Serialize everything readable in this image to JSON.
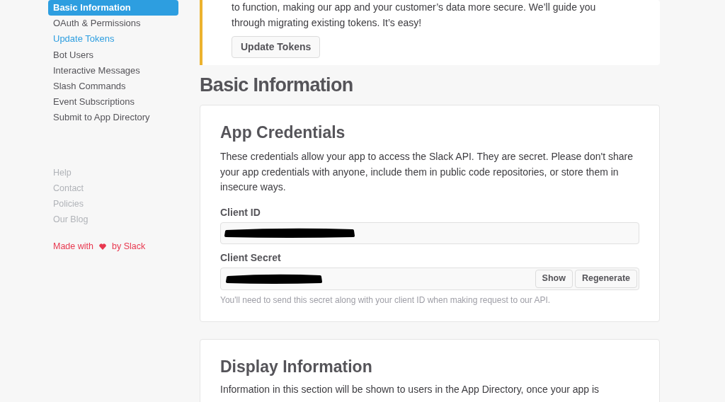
{
  "sidebar": {
    "items": [
      {
        "label": "Basic Information",
        "selected": true,
        "kind": "nav"
      },
      {
        "label": "OAuth & Permissions",
        "selected": false,
        "kind": "nav"
      },
      {
        "label": "Update Tokens",
        "selected": false,
        "kind": "highlight"
      },
      {
        "label": "Bot Users",
        "selected": false,
        "kind": "nav"
      },
      {
        "label": "Interactive Messages",
        "selected": false,
        "kind": "nav"
      },
      {
        "label": "Slash Commands",
        "selected": false,
        "kind": "nav"
      },
      {
        "label": "Event Subscriptions",
        "selected": false,
        "kind": "nav"
      },
      {
        "label": "Submit to App Directory",
        "selected": false,
        "kind": "nav"
      }
    ],
    "footer_links": [
      "Help",
      "Contact",
      "Policies",
      "Our Blog"
    ],
    "made_with": {
      "before": "Made with",
      "after": "by Slack"
    }
  },
  "banner": {
    "text": "to function, making our app and your customer’s data more secure. We’ll guide you through migrating existing tokens. It’s easy!",
    "button": "Update Tokens"
  },
  "page_title": "Basic Information",
  "credentials": {
    "title": "App Credentials",
    "description": "These credentials allow your app to access the Slack API. They are secret. Please don't share your app credentials with anyone, include them in public code repositories, or store them in insecure ways.",
    "client_id": {
      "label": "Client ID"
    },
    "client_secret": {
      "label": "Client Secret",
      "buttons": [
        "Show",
        "Regenerate"
      ],
      "help": "You'll need to send this secret along with your client ID when making request to our API."
    }
  },
  "display": {
    "title": "Display Information",
    "description": "Information in this section will be shown to users in the App Directory, once your app is"
  }
}
